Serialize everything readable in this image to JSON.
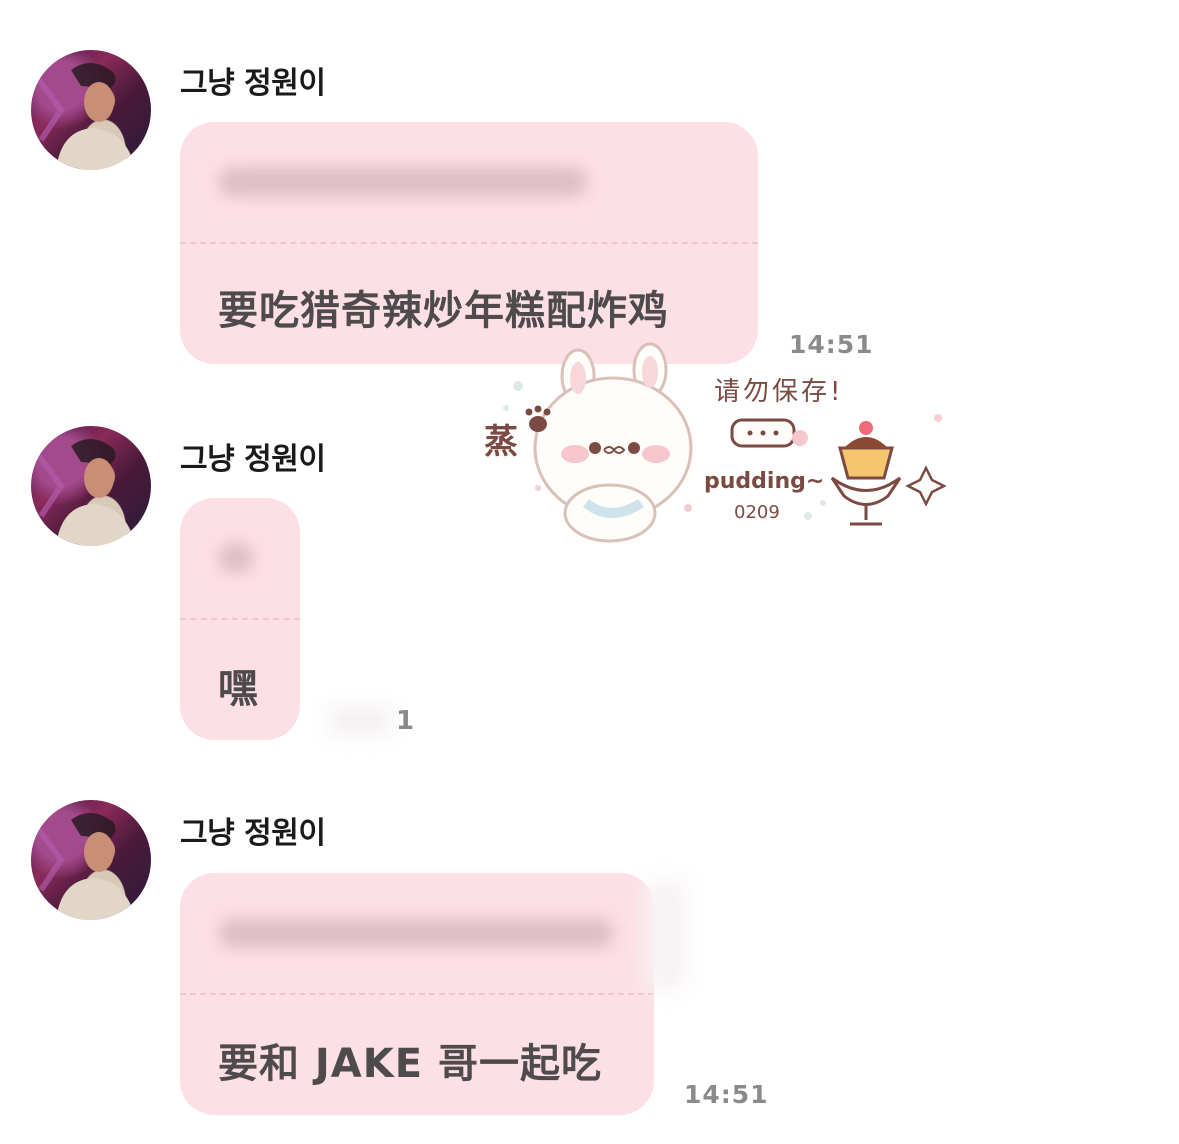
{
  "messages": [
    {
      "sender": "그냥 정원이",
      "text": "要吃猎奇辣炒年糕配炸鸡",
      "time": "14:51"
    },
    {
      "sender": "그냥 정원이",
      "text": "嘿",
      "unread": "1"
    },
    {
      "sender": "그냥 정원이",
      "text": "要和 JAKE 哥一起吃",
      "time": "14:51"
    }
  ],
  "sticker": {
    "side_char": "蒸",
    "caption": "请勿保存!",
    "brand": "pudding~",
    "code": "0209"
  },
  "colors": {
    "bubble": "#fde0e6",
    "divider": "#efc6cf",
    "text": "#4f4b4c",
    "sender": "#1a1a1a",
    "time": "#8a8a8a"
  }
}
